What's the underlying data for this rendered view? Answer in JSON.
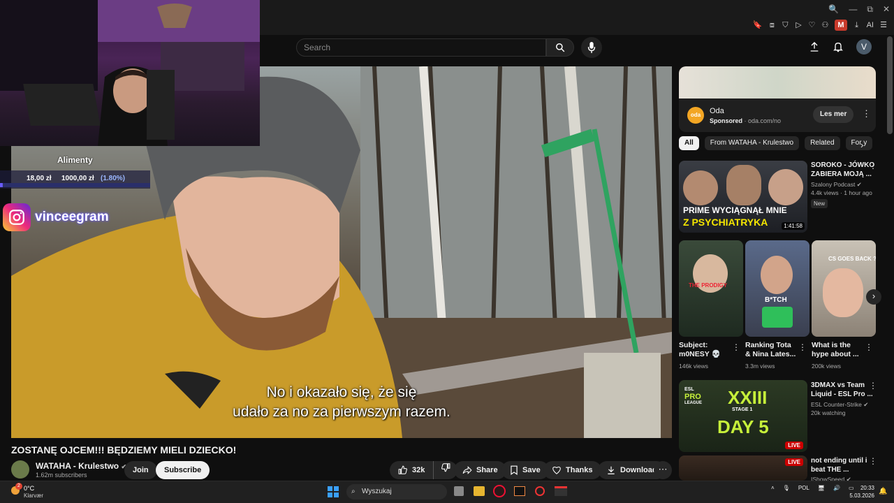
{
  "colors": {
    "accent": "#ff0000",
    "page_bg": "#0f0f0f",
    "chip_active": "#f1f1f1",
    "insta_glow": "#6a5cff",
    "live": "#cc0000"
  },
  "browser": {
    "window_buttons": [
      "🔍",
      "—",
      "⧉",
      "✕"
    ],
    "extensions": [
      "🔖",
      "⧈",
      "⛉",
      "▷",
      "♡",
      "⚇",
      "M",
      "⤓",
      "AI",
      "☰"
    ]
  },
  "header": {
    "search_placeholder": "Search"
  },
  "overlay": {
    "donation": {
      "name": "Alimenty",
      "current": "18,00 zł",
      "goal": "1000,00 zł",
      "percent": "(1.80%)",
      "fraction": 0.018
    },
    "instagram_handle": "vinceegram"
  },
  "video": {
    "subtitle_line1": "No i okazało się, że się",
    "subtitle_line2": "udało za no za pierwszym razem.",
    "title": "ZOSTANĘ OJCEM!!! BĘDZIEMY MIELI DZIECKO!"
  },
  "channel": {
    "name": "WATAHA - Krulestwo",
    "subscribers": "1.62m subscribers",
    "join_label": "Join",
    "subscribe_label": "Subscribe"
  },
  "actions": {
    "likes": "32k",
    "share": "Share",
    "save": "Save",
    "thanks": "Thanks",
    "download": "Download"
  },
  "ad": {
    "logo": "oda",
    "name": "Oda",
    "sponsored": "Sponsored",
    "domain": " · oda.com/no",
    "button": "Les mer"
  },
  "chips": [
    "All",
    "From WATAHA - Krulestwo",
    "Related",
    "For y"
  ],
  "recs": [
    {
      "title_l1": "SOROKO - JÓWKO",
      "title_l2": "ZABIERA MOJĄ ...",
      "channel": "Szalony Podcast ✔",
      "meta": "4.4k views · 1 hour ago",
      "badge": "New",
      "thumb_text1": "PRIME WYCIĄGNĄŁ MNIE",
      "thumb_text2": "Z PSYCHIATRYKA",
      "duration": "1:41:58"
    },
    {
      "title_l1": "3DMAX vs Team",
      "title_l2": "Liquid - ESL Pro ...",
      "channel": "ESL Counter-Strike ✔",
      "meta": "20k watching",
      "thumb_text1": "PRO",
      "thumb_text2": "XXIII",
      "thumb_text3": "DAY 5",
      "live": "LIVE",
      "esl": "ESL",
      "league": "LEAGUE",
      "stage": "STAGE 1"
    },
    {
      "title_l1": "not ending until i",
      "title_l2": "beat THE ...",
      "channel": "IShowSpeed ✔",
      "live": "LIVE"
    }
  ],
  "shorts": [
    {
      "title_l1": "Subject:",
      "title_l2": "m0NESY 💀",
      "views": "146k views",
      "thumb_text": "THE PRODIGY"
    },
    {
      "title_l1": "Ranking Tota",
      "title_l2": "& Nina Lates...",
      "views": "3.3m views",
      "thumb_text": "B*TCH"
    },
    {
      "title_l1": "What is the",
      "title_l2": "hype about ...",
      "views": "200k views",
      "thumb_text": "CS GOES BACK ?!"
    }
  ],
  "taskbar": {
    "temp": "0°C",
    "weather": "Klarvær",
    "search": "Wyszukaj",
    "lang": "POL",
    "time": "20:33",
    "date": "5.03.2026",
    "notif": "2"
  }
}
